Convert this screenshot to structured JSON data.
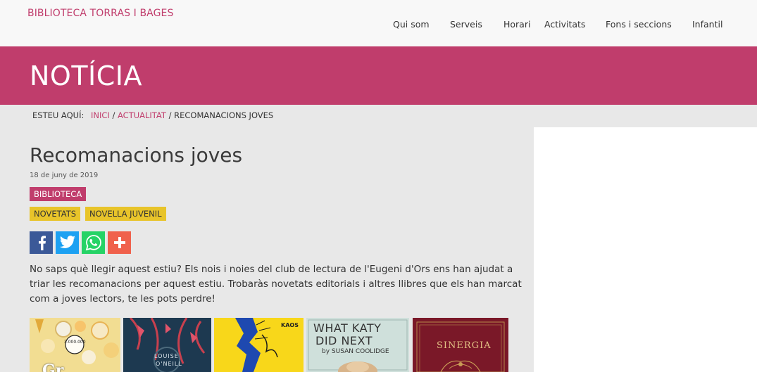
{
  "site": {
    "brand": "BIBLIOTECA TORRAS I BAGES"
  },
  "nav": [
    {
      "label": "Qui som"
    },
    {
      "label": "Serveis"
    },
    {
      "label": "Horari"
    },
    {
      "label": "Activitats"
    },
    {
      "label": "Fons i seccions"
    },
    {
      "label": "Infantil"
    }
  ],
  "banner": {
    "title": "NOTÍCIA"
  },
  "breadcrumb": {
    "lead": "ESTEU AQUÍ:",
    "items": [
      {
        "label": "INICI"
      },
      {
        "label": "ACTUALITAT"
      }
    ],
    "separator": "/",
    "current": "RECOMANACIONS JOVES"
  },
  "article": {
    "title": "Recomanacions joves",
    "date": "18 de juny de 2019",
    "categories": [
      {
        "label": "BIBLIOTECA"
      }
    ],
    "tags": [
      {
        "label": "NOVETATS"
      },
      {
        "label": "NOVELLA JUVENIL"
      }
    ],
    "intro": "No saps què llegir aquest estiu? Els nois i noies del club de lectura de l'Eugeni d'Ors ens han ajudat a triar les recomanacions per aquest estiu. Trobaràs novetats editorials i altres llibres que els han marcat com a joves lectors, te les pots perdre!"
  },
  "share": [
    {
      "icon": "facebook-icon",
      "color": "#3b5998"
    },
    {
      "icon": "twitter-icon",
      "color": "#1da1f2"
    },
    {
      "icon": "whatsapp-icon",
      "color": "#25d366"
    },
    {
      "icon": "plus-icon",
      "color": "#f0614c"
    }
  ],
  "books": [
    {
      "cover_text": [
        "Gr",
        "3.000.000"
      ],
      "color": "#f1d98a"
    },
    {
      "cover_text": [
        "LOUISE",
        "O'NEILL"
      ],
      "color": "#1f3a4f"
    },
    {
      "cover_text": [
        "KAOS"
      ],
      "color": "#f7d617"
    },
    {
      "cover_text": [
        "WHAT KATY",
        "DID NEXT",
        "by SUSAN COOLIDGE"
      ],
      "color": "#c9ddd8"
    },
    {
      "cover_text": [
        "SINERGIA"
      ],
      "color": "#7d1a2a"
    }
  ],
  "colors": {
    "accent": "#c03d6c",
    "tag_yellow": "#e8c42a"
  }
}
